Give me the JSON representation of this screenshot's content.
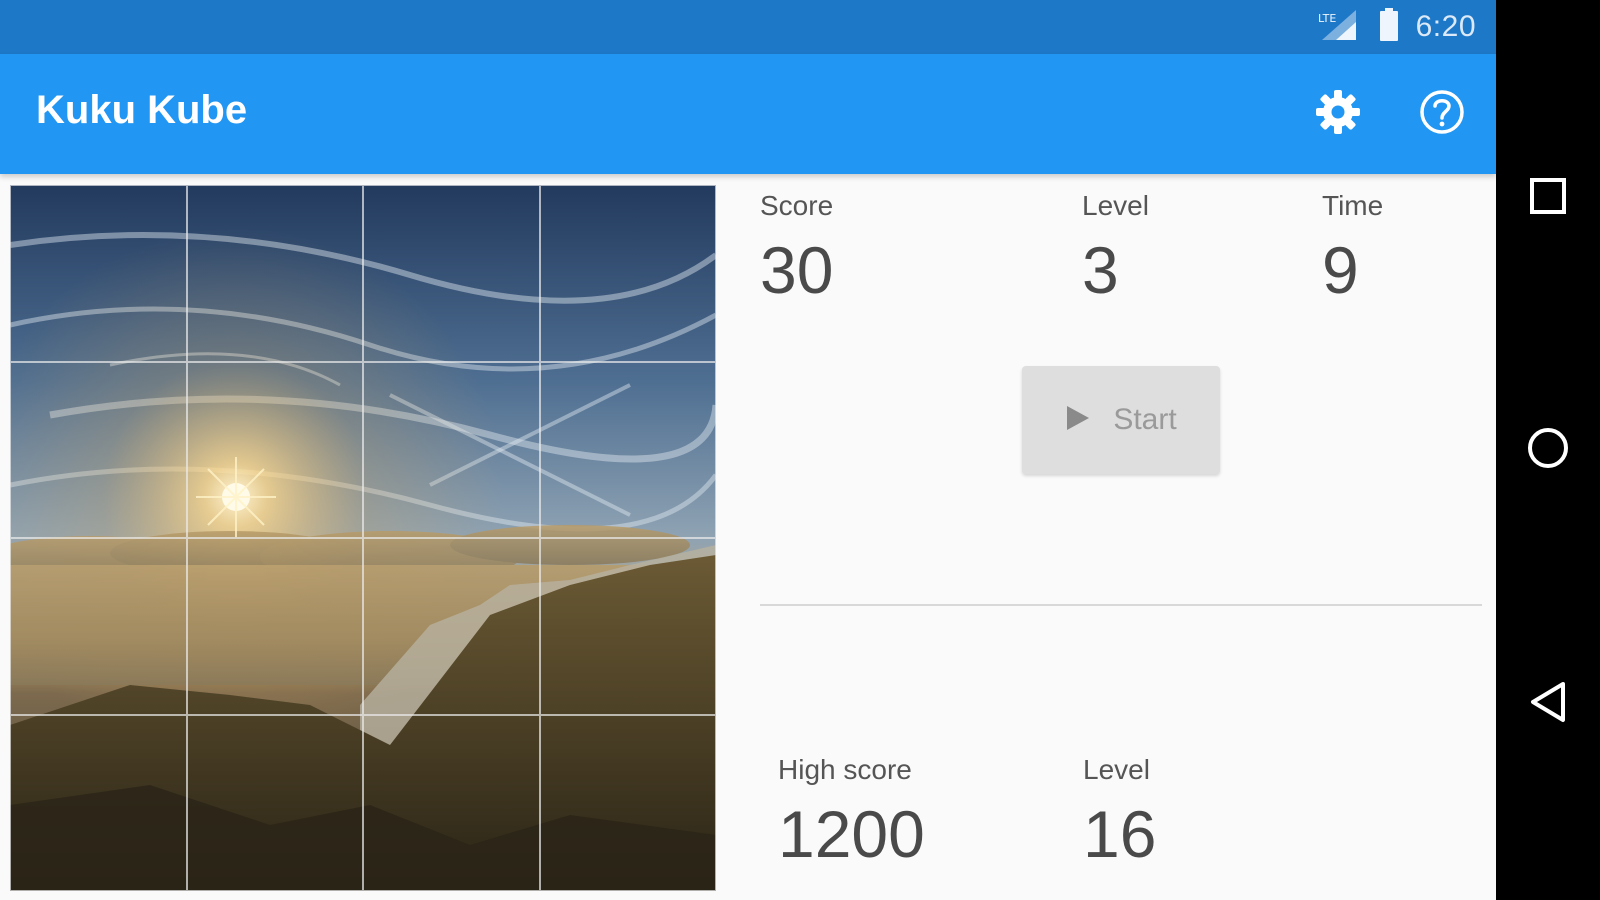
{
  "status_bar": {
    "time": "6:20",
    "network": "LTE"
  },
  "app_bar": {
    "title": "Kuku Kube",
    "icons": [
      "gear-icon",
      "help-icon"
    ]
  },
  "puzzle": {
    "grid_size": 4
  },
  "current": {
    "score_label": "Score",
    "score_value": "30",
    "level_label": "Level",
    "level_value": "3",
    "time_label": "Time",
    "time_value": "9"
  },
  "start_button": {
    "label": "Start",
    "icon": "play-icon"
  },
  "best": {
    "high_score_label": "High score",
    "high_score_value": "1200",
    "level_label": "Level",
    "level_value": "16"
  },
  "nav_bar": {
    "icons": [
      "recents-icon",
      "home-icon",
      "back-icon"
    ]
  },
  "colors": {
    "status_bar": "#1e78c8",
    "app_bar": "#2196f3",
    "background": "#fafafa",
    "button": "#dedede"
  }
}
